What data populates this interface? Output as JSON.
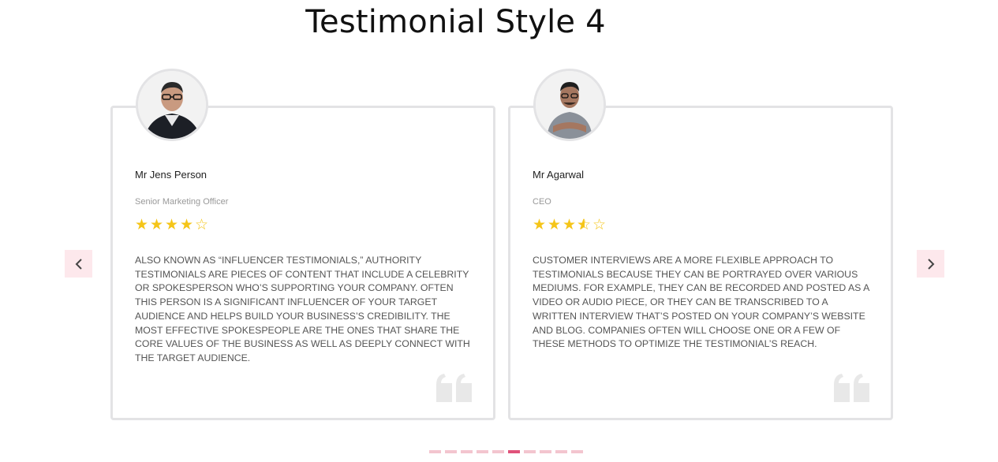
{
  "page": {
    "title": "Testimonial Style 4"
  },
  "carousel": {
    "prev_icon": "chevron-left-icon",
    "next_icon": "chevron-right-icon",
    "dot_count": 10,
    "active_dot": 5,
    "dot_color": "#f3c5cf",
    "active_dot_color": "#e0527a",
    "nav_bg_color": "#fde8ec"
  },
  "testimonials": [
    {
      "name": "Mr Jens Person",
      "role": "Senior Marketing Officer",
      "rating": 4,
      "max_rating": 5,
      "text": "ALSO KNOWN AS “INFLUENCER TESTIMONIALS,” AUTHORITY TESTIMONIALS ARE PIECES OF CONTENT THAT INCLUDE A CELEBRITY OR SPOKESPERSON WHO’S SUPPORTING YOUR COMPANY. OFTEN THIS PERSON IS A SIGNIFICANT INFLUENCER OF YOUR TARGET AUDIENCE AND HELPS BUILD YOUR BUSINESS’S CREDIBILITY. THE MOST EFFECTIVE SPOKESPEOPLE ARE THE ONES THAT SHARE THE CORE VALUES OF THE BUSINESS AS WELL AS DEEPLY CONNECT WITH THE TARGET AUDIENCE."
    },
    {
      "name": "Mr Agarwal",
      "role": "CEO",
      "rating": 3.5,
      "max_rating": 5,
      "text": "CUSTOMER INTERVIEWS ARE A MORE FLEXIBLE APPROACH TO TESTIMONIALS BECAUSE THEY CAN BE PORTRAYED OVER VARIOUS MEDIUMS. FOR EXAMPLE, THEY CAN BE RECORDED AND POSTED AS A VIDEO OR AUDIO PIECE, OR THEY CAN BE TRANSCRIBED TO A WRITTEN INTERVIEW THAT’S POSTED ON YOUR COMPANY’S WEBSITE AND BLOG. COMPANIES OFTEN WILL CHOOSE ONE OR A FEW OF THESE METHODS TO OPTIMIZE THE TESTIMONIAL’S REACH."
    }
  ]
}
